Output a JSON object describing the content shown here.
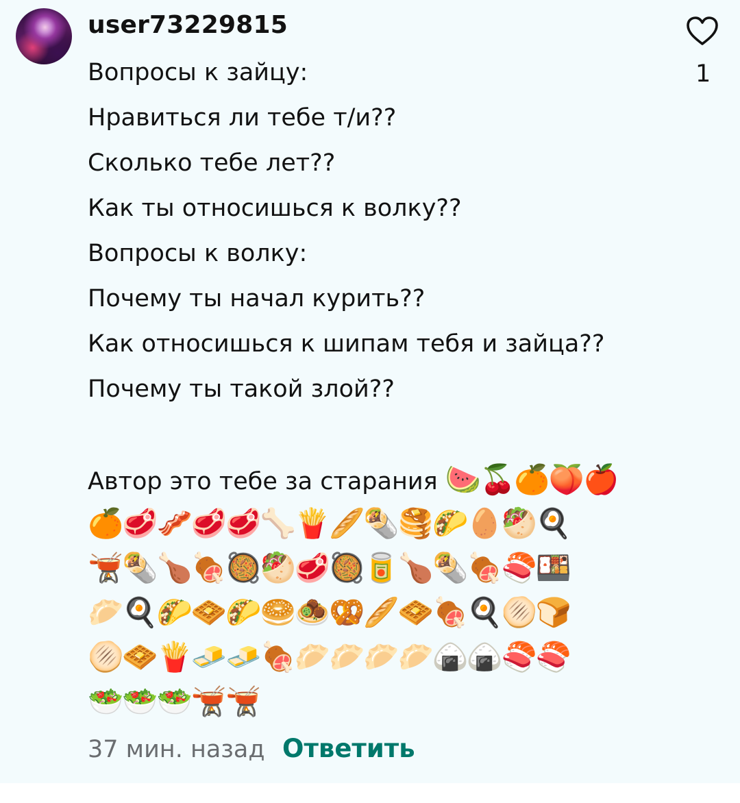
{
  "comment": {
    "username": "user73229815",
    "avatar_icon": "anime-avatar-icon",
    "lines": [
      "Вопросы к зайцу:",
      "Нравиться ли тебе т/и??",
      "Сколько тебе лет??",
      "Как ты относишься к волку??",
      "Вопросы к волку:",
      "Почему ты начал курить??",
      "Как относишься к шипам тебя и зайца??",
      "Почему ты такой злой??",
      "",
      "Автор это тебе за старания"
    ],
    "emoji_rows": [
      "🍉🍒🍊🍑🍎",
      "🍊🥩🥓🥩🥩🦴🍟🥖🌯🥞🌮🥚🥙🍳",
      "🫕🌯🍗🍖🥘🥙🥩🥘🥫🍗🌯🍖🍣🍱",
      "🥟🍳🌮🧇🌮🥯🧆🥨🥖🧇🍖🍳🫓🍞",
      "🫓🧇🍟🧈🧈🍖🥟🥟🥟🥟🍙🍙🍣🍣",
      "🥗🥗🥗🫕🫕"
    ],
    "timestamp": "37 мин. назад",
    "reply_label": "Ответить",
    "like_icon": "heart-icon",
    "like_count": "1",
    "colors": {
      "background": "#f3fbfd",
      "text": "#121212",
      "meta": "#6a6d70",
      "accent": "#00786b"
    }
  }
}
